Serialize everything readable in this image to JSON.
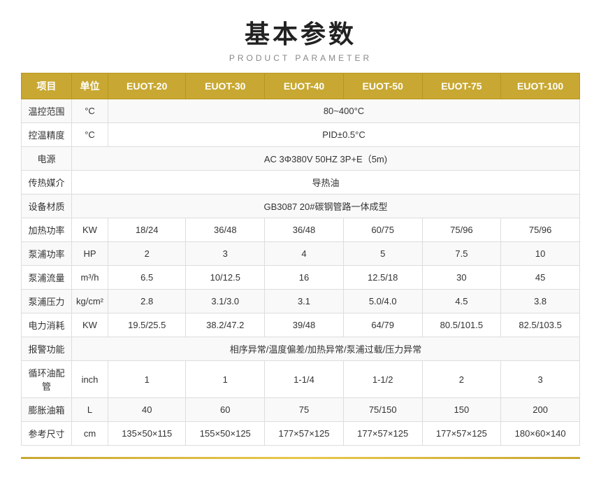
{
  "title": {
    "main": "基本参数",
    "sub": "PRODUCT PARAMETER"
  },
  "table": {
    "headers": [
      "项目",
      "单位",
      "EUOT-20",
      "EUOT-30",
      "EUOT-40",
      "EUOT-50",
      "EUOT-75",
      "EUOT-100"
    ],
    "rows": [
      {
        "label": "温控范围",
        "unit": "°C",
        "values": [
          "80~400°C"
        ],
        "span": 6
      },
      {
        "label": "控温精度",
        "unit": "°C",
        "values": [
          "PID±0.5°C"
        ],
        "span": 6
      },
      {
        "label": "电源",
        "unit": "",
        "values": [
          "AC 3Φ380V 50HZ 3P+E（5m)"
        ],
        "span": 7
      },
      {
        "label": "传热媒介",
        "unit": "",
        "values": [
          "导热油"
        ],
        "span": 7
      },
      {
        "label": "设备材质",
        "unit": "",
        "values": [
          "GB3087   20#碳钢管路一体成型"
        ],
        "span": 7
      },
      {
        "label": "加热功率",
        "unit": "KW",
        "values": [
          "18/24",
          "36/48",
          "36/48",
          "60/75",
          "75/96",
          "75/96"
        ],
        "span": 1
      },
      {
        "label": "泵浦功率",
        "unit": "HP",
        "values": [
          "2",
          "3",
          "4",
          "5",
          "7.5",
          "10"
        ],
        "span": 1
      },
      {
        "label": "泵浦流量",
        "unit": "m³/h",
        "values": [
          "6.5",
          "10/12.5",
          "16",
          "12.5/18",
          "30",
          "45"
        ],
        "span": 1
      },
      {
        "label": "泵浦压力",
        "unit": "kg/cm²",
        "values": [
          "2.8",
          "3.1/3.0",
          "3.1",
          "5.0/4.0",
          "4.5",
          "3.8"
        ],
        "span": 1
      },
      {
        "label": "电力消耗",
        "unit": "KW",
        "values": [
          "19.5/25.5",
          "38.2/47.2",
          "39/48",
          "64/79",
          "80.5/101.5",
          "82.5/103.5"
        ],
        "span": 1
      },
      {
        "label": "报警功能",
        "unit": "",
        "values": [
          "相序异常/温度偏差/加热异常/泵浦过载/压力异常"
        ],
        "span": 7
      },
      {
        "label": "循环油配管",
        "unit": "inch",
        "values": [
          "1",
          "1",
          "1-1/4",
          "1-1/2",
          "2",
          "3"
        ],
        "span": 1
      },
      {
        "label": "膨胀油箱",
        "unit": "L",
        "values": [
          "40",
          "60",
          "75",
          "75/150",
          "150",
          "200"
        ],
        "span": 1
      },
      {
        "label": "参考尺寸",
        "unit": "cm",
        "values": [
          "135×50×115",
          "155×50×125",
          "177×57×125",
          "177×57×125",
          "177×57×125",
          "180×60×140"
        ],
        "span": 1
      }
    ]
  }
}
